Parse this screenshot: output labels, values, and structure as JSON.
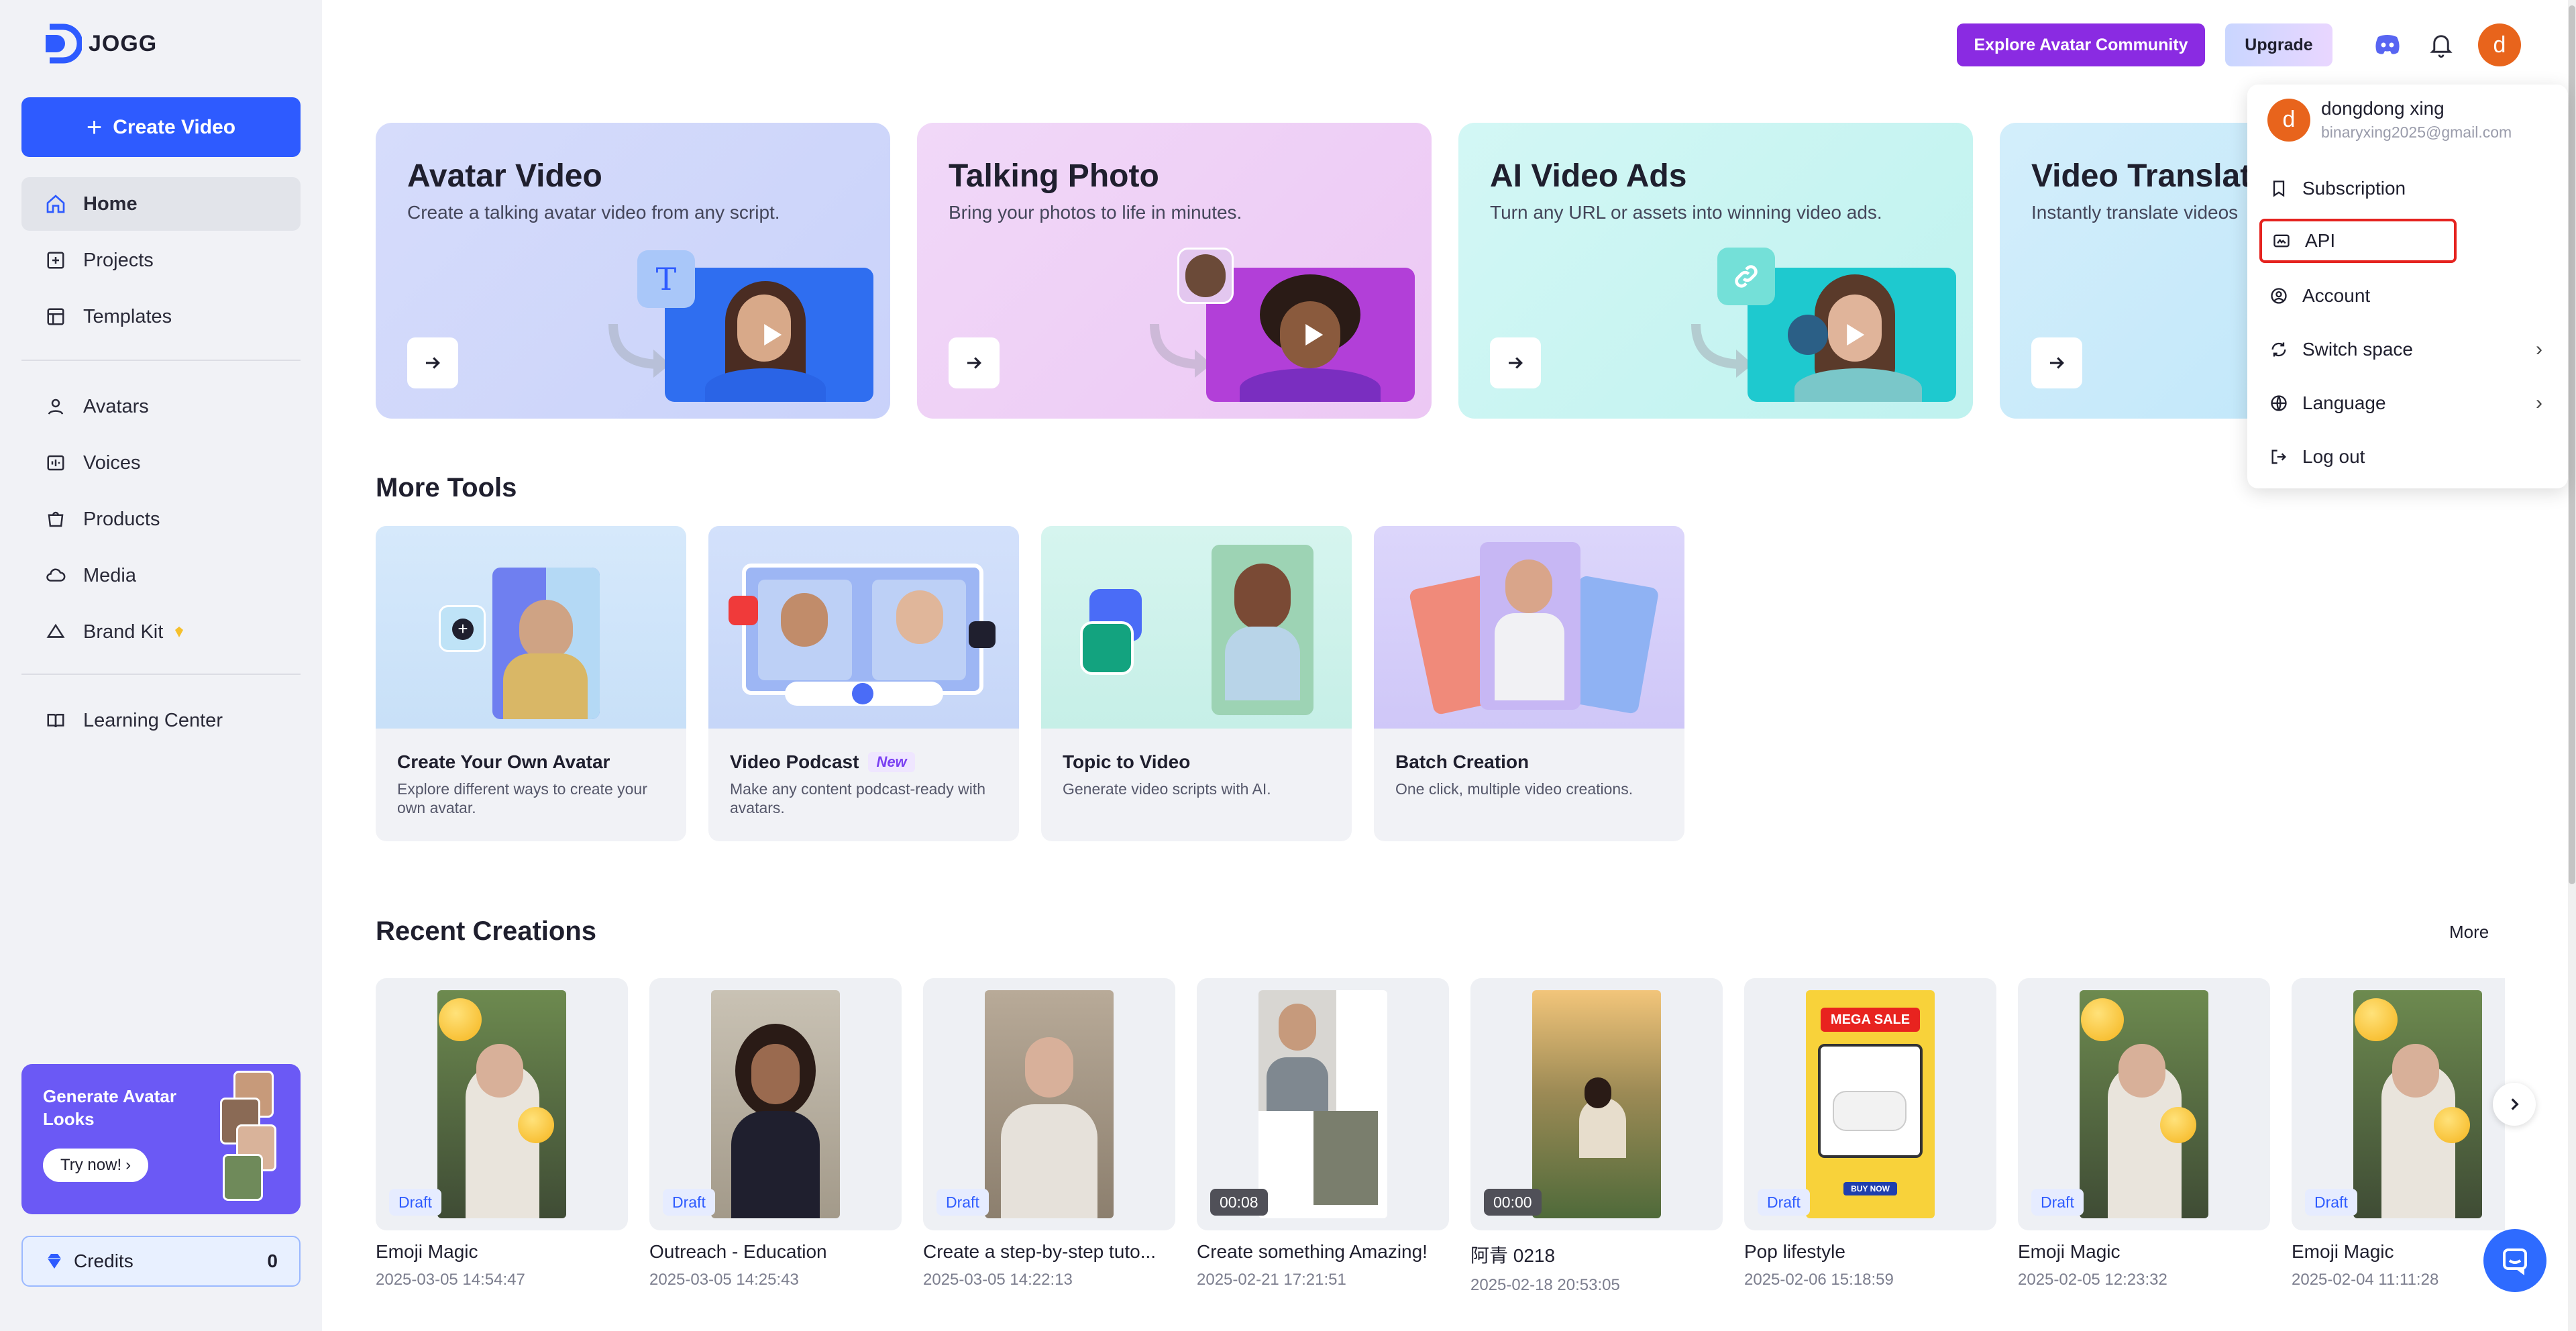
{
  "app": {
    "logo_text": "JOGG"
  },
  "sidebar": {
    "create_label": "Create Video",
    "items": [
      {
        "label": "Home",
        "icon": "home-icon",
        "active": true
      },
      {
        "label": "Projects",
        "icon": "projects-icon"
      },
      {
        "label": "Templates",
        "icon": "templates-icon"
      },
      {
        "label": "Avatars",
        "icon": "avatars-icon"
      },
      {
        "label": "Voices",
        "icon": "voices-icon"
      },
      {
        "label": "Products",
        "icon": "products-icon"
      },
      {
        "label": "Media",
        "icon": "media-icon"
      },
      {
        "label": "Brand Kit",
        "icon": "brand-kit-icon"
      },
      {
        "label": "Learning Center",
        "icon": "learning-center-icon"
      }
    ],
    "promo": {
      "title": "Generate Avatar Looks",
      "button": "Try now!"
    },
    "credits": {
      "label": "Credits",
      "value": "0"
    }
  },
  "topbar": {
    "explore_label": "Explore Avatar Community",
    "upgrade_label": "Upgrade",
    "avatar_initial": "d"
  },
  "hero_cards": [
    {
      "title": "Avatar Video",
      "subtitle": "Create a talking avatar video from any script."
    },
    {
      "title": "Talking Photo",
      "subtitle": "Bring your photos to life in minutes."
    },
    {
      "title": "AI Video Ads",
      "subtitle": "Turn any URL or assets into winning video ads."
    },
    {
      "title": "Video Translat",
      "subtitle": "Instantly translate videos"
    }
  ],
  "more_tools": {
    "title": "More Tools",
    "items": [
      {
        "title": "Create Your Own Avatar",
        "desc": "Explore different ways to create your own avatar."
      },
      {
        "title": "Video Podcast",
        "badge": "New",
        "desc": "Make any content podcast-ready with avatars."
      },
      {
        "title": "Topic to Video",
        "desc": "Generate video scripts with AI."
      },
      {
        "title": "Batch Creation",
        "desc": "One click, multiple video creations."
      }
    ]
  },
  "recent": {
    "title": "Recent Creations",
    "more": "More",
    "items": [
      {
        "title": "Emoji Magic",
        "date": "2025-03-05 14:54:47",
        "badge": "Draft"
      },
      {
        "title": "Outreach - Education",
        "date": "2025-03-05 14:25:43",
        "badge": "Draft"
      },
      {
        "title": "Create a step-by-step tuto...",
        "date": "2025-03-05 14:22:13",
        "badge": "Draft"
      },
      {
        "title": "Create something Amazing!",
        "date": "2025-02-21 17:21:51",
        "badge": "00:08"
      },
      {
        "title": "阿青 0218",
        "date": "2025-02-18 20:53:05",
        "badge": "00:00"
      },
      {
        "title": "Pop lifestyle",
        "date": "2025-02-06 15:18:59",
        "badge": "Draft"
      },
      {
        "title": "Emoji Magic",
        "date": "2025-02-05 12:23:32",
        "badge": "Draft"
      },
      {
        "title": "Emoji Magic",
        "date": "2025-02-04 11:11:28",
        "badge": "Draft"
      }
    ],
    "sale_banner": "MEGA SALE",
    "sale_button": "BUY NOW"
  },
  "user_menu": {
    "name": "dongdong xing",
    "email": "binaryxing2025@gmail.com",
    "initial": "d",
    "items": [
      {
        "label": "Subscription",
        "icon": "bookmark-icon"
      },
      {
        "label": "API",
        "icon": "api-icon",
        "highlighted": true
      },
      {
        "label": "Account",
        "icon": "account-icon"
      },
      {
        "label": "Switch space",
        "icon": "switch-space-icon",
        "submenu": true
      },
      {
        "label": "Language",
        "icon": "globe-icon",
        "submenu": true
      },
      {
        "label": "Log out",
        "icon": "logout-icon"
      }
    ]
  },
  "colors": {
    "primary": "#2e5bff",
    "explore": "#8a2be2",
    "highlight_border": "#e5231f",
    "avatar": "#e8641c"
  }
}
